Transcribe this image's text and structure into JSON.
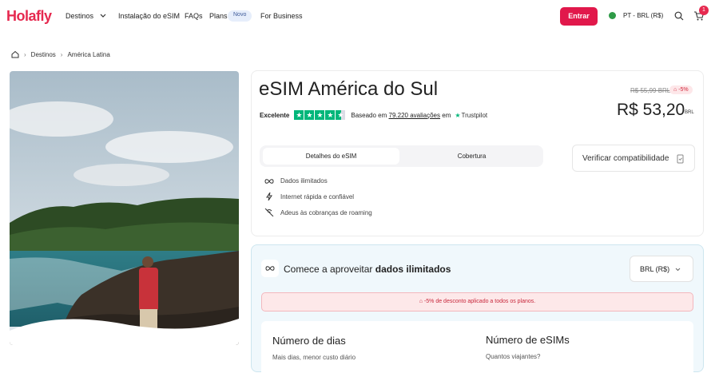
{
  "nav": {
    "logo": "Holafly",
    "destinos": "Destinos",
    "instalacao": "Instalação do eSIM",
    "faqs": "FAQs",
    "plans": "Plans",
    "novo_badge": "Novo",
    "business": "For Business",
    "entrar": "Entrar",
    "lang": "PT - BRL (R$)",
    "cart_count": "1"
  },
  "breadcrumb": {
    "destinos": "Destinos",
    "region": "América Latina"
  },
  "product": {
    "title": "eSIM América do Sul",
    "rating_word": "Excelente",
    "based_on": "Baseado em",
    "reviews": "79.220 avaliações",
    "em": "em",
    "trustpilot": "Trustpilot",
    "old_price": "R$ 55,99 BRL",
    "discount": "-5%",
    "price": "R$ 53,20",
    "currency": "BRL"
  },
  "tabs": {
    "details": "Detalhes do eSIM",
    "coverage": "Cobertura"
  },
  "verify_label": "Verificar compatibilidade",
  "features": [
    "Dados ilimitados",
    "Internet rápida e confiável",
    "Adeus às cobranças de roaming"
  ],
  "plan": {
    "start_prefix": "Comece a aproveitar",
    "start_bold": "dados ilimitados",
    "currency_select": "BRL (R$)",
    "banner": "-5% de desconto aplicado a todos os planos.",
    "days_title": "Número de dias",
    "days_sub": "Mais dias, menor custo diário",
    "esims_title": "Número de eSIMs",
    "esims_sub": "Quantos viajantes?"
  },
  "colors": {
    "brand": "#e6294f",
    "trustpilot": "#00b67a"
  }
}
